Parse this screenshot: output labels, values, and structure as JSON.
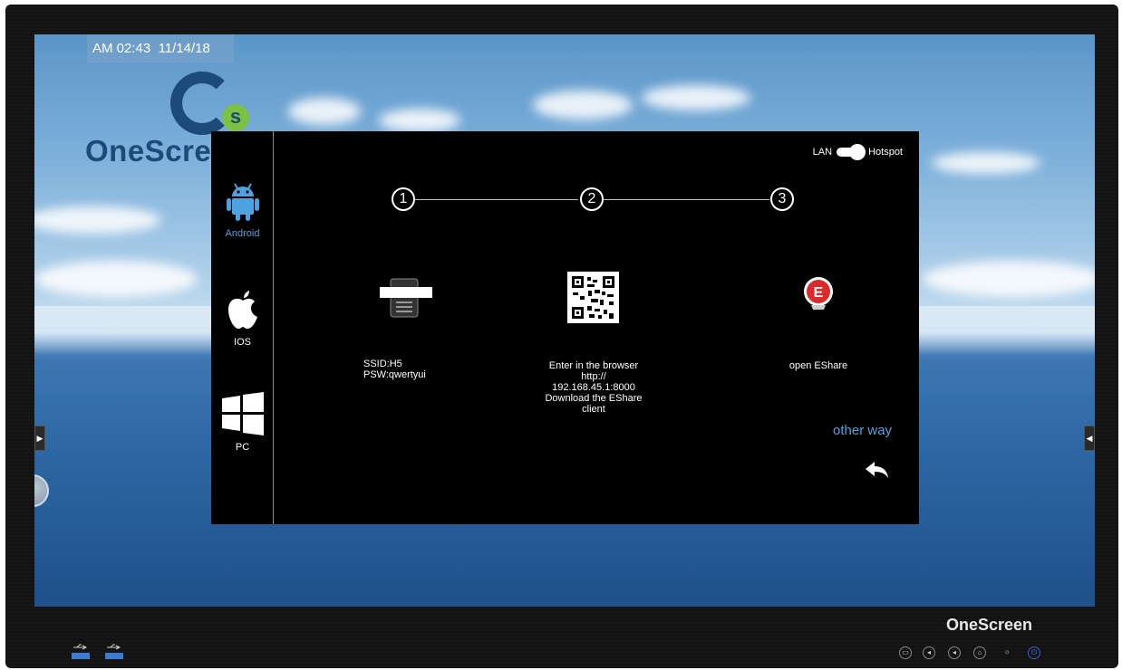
{
  "status": {
    "time": "AM 02:43",
    "date": "11/14/18"
  },
  "brand": {
    "logo_text": "OneScre",
    "logo_letter": "s",
    "bottom_brand": "OneScreen"
  },
  "dialog": {
    "os_tabs": [
      {
        "label": "Android",
        "icon": "android-icon",
        "selected": true,
        "color": "#4da3e0"
      },
      {
        "label": "IOS",
        "icon": "apple-icon",
        "selected": false
      },
      {
        "label": "PC",
        "icon": "windows-icon",
        "selected": false
      }
    ],
    "network_toggle": {
      "left_label": "LAN",
      "right_label": "Hotspot",
      "state": "Hotspot"
    },
    "steps": [
      {
        "number": "1",
        "line1": "SSID:H5",
        "line2": "PSW:qwertyui"
      },
      {
        "number": "2",
        "line1": "Enter in the browser",
        "line2": "http://",
        "line3": "192.168.45.1:8000",
        "line4": "Download the EShare",
        "line5": "client"
      },
      {
        "number": "3",
        "line1": "open EShare"
      }
    ],
    "other_way": "other way",
    "accent": "#4da3e0"
  },
  "bottom_controls": [
    "display-icon",
    "volume-down-icon",
    "volume-up-icon",
    "home-icon",
    "brightness-icon",
    "power-icon"
  ]
}
